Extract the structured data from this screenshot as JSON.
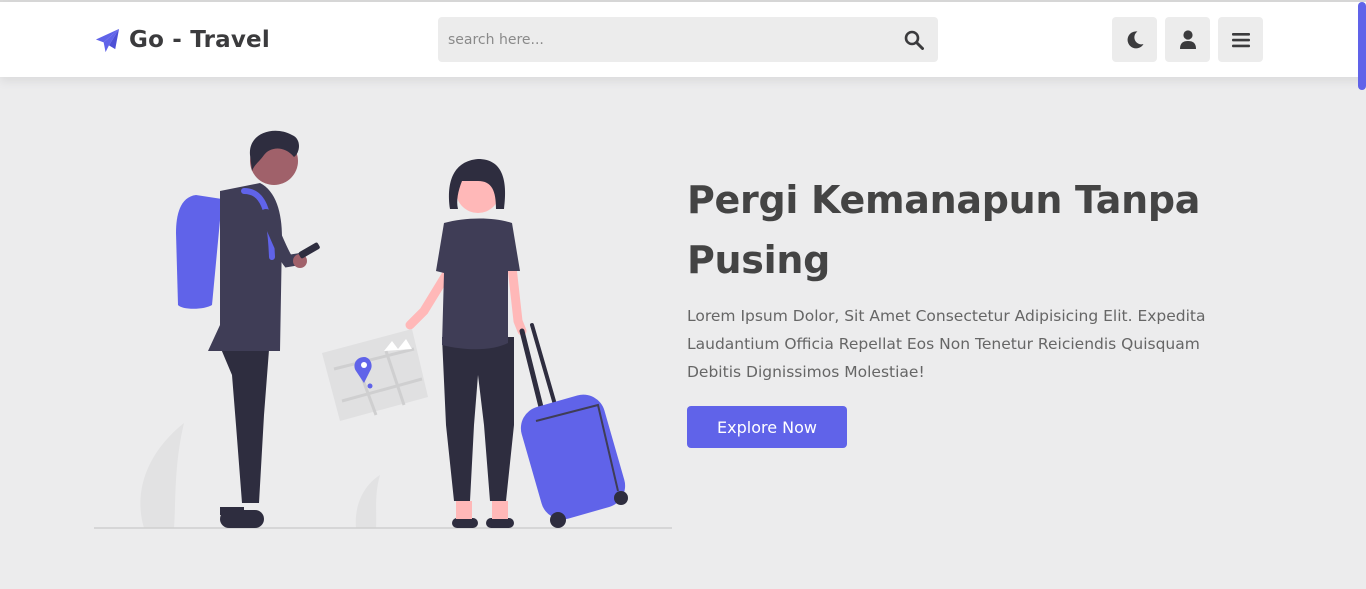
{
  "colors": {
    "accent": "#6063e9",
    "background": "#ececed",
    "navbar": "#ffffff",
    "text_dark": "#444444",
    "text_muted": "#666666"
  },
  "header": {
    "logo_icon": "paper-plane-icon",
    "brand": "Go - Travel",
    "search_placeholder": "search here...",
    "search_icon": "search-icon",
    "buttons": [
      {
        "icon": "moon-icon",
        "label": "theme toggle"
      },
      {
        "icon": "user-icon",
        "label": "account"
      },
      {
        "icon": "bars-icon",
        "label": "menu"
      }
    ]
  },
  "hero": {
    "title": "Pergi Kemanapun Tanpa Pusing",
    "description": "Lorem Ipsum Dolor, Sit Amet Consectetur Adipisicing Elit. Expedita Laudantium Officia Repellat Eos Non Tenetur Reiciendis Quisquam Debitis Dignissimos Molestiae!",
    "cta": "Explore Now"
  }
}
